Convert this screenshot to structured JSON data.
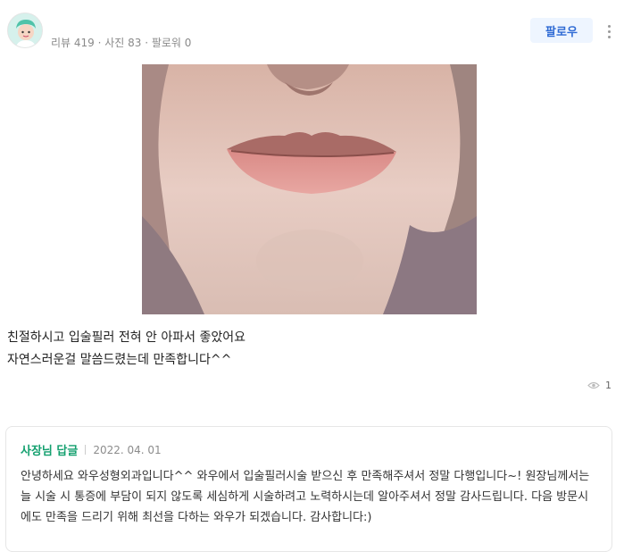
{
  "profile": {
    "stats": [
      {
        "label": "리뷰",
        "value": "419"
      },
      {
        "label": "사진",
        "value": "83"
      },
      {
        "label": "팔로워",
        "value": "0"
      }
    ],
    "stats_text": "리뷰 419 · 사진 83 · 팔로워 0",
    "follow_label": "팔로우"
  },
  "review": {
    "lines": [
      "친절하시고 입술필러 전혀 안 아파서 좋았어요",
      "자연스러운걸 말씀드렸는데 만족합니다^^"
    ],
    "view_count": "1"
  },
  "reply": {
    "author_label": "사장님 답글",
    "date": "2022. 04. 01",
    "body": "안녕하세요 와우성형외과입니다^^ 와우에서 입술필러시술 받으신 후 만족해주셔서 정말 다행입니다~! 원장님께서는 늘 시술 시 통증에 부담이 되지 않도록 세심하게 시술하려고 노력하시는데 알아주셔서 정말 감사드립니다. 다음 방문시에도 만족을 드리기 위해 최선을 다하는 와우가 되겠습니다. 감사합니다:)"
  },
  "colors": {
    "accent_blue": "#2e6ad4",
    "follow_bg": "#eef5ff",
    "owner_green": "#14a06f"
  }
}
